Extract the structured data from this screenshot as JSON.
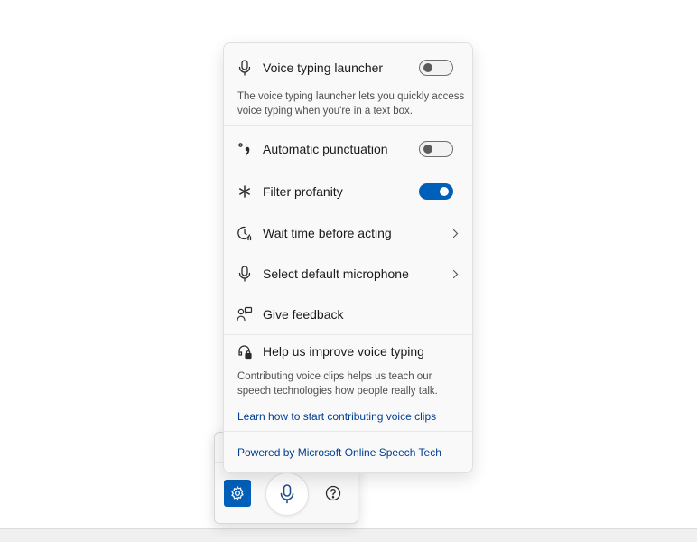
{
  "flyout": {
    "voice_typing_launcher": {
      "label": "Voice typing launcher",
      "toggle_on": false,
      "description": "The voice typing launcher lets you quickly access voice typing when you're in a text box.",
      "icon": "microphone-icon"
    },
    "automatic_punctuation": {
      "label": "Automatic punctuation",
      "toggle_on": false,
      "icon": "punctuation-icon"
    },
    "filter_profanity": {
      "label": "Filter profanity",
      "toggle_on": true,
      "icon": "asterisk-icon"
    },
    "wait_time": {
      "label": "Wait time before acting",
      "icon": "timer-icon"
    },
    "default_microphone": {
      "label": "Select default microphone",
      "icon": "microphone-icon"
    },
    "feedback": {
      "label": "Give feedback",
      "icon": "feedback-icon"
    },
    "improve": {
      "label": "Help us improve voice typing",
      "description": "Contributing voice clips helps us teach our speech technologies how people really talk.",
      "link": "Learn how to start contributing voice clips",
      "icon": "voice-lock-icon"
    },
    "powered_by": "Powered by Microsoft Online Speech Tech"
  },
  "toolbar": {
    "settings_icon": "gear-icon",
    "mic_icon": "microphone-icon",
    "help_icon": "help-icon"
  },
  "colors": {
    "accent": "#005fb8",
    "link": "#003e92"
  }
}
